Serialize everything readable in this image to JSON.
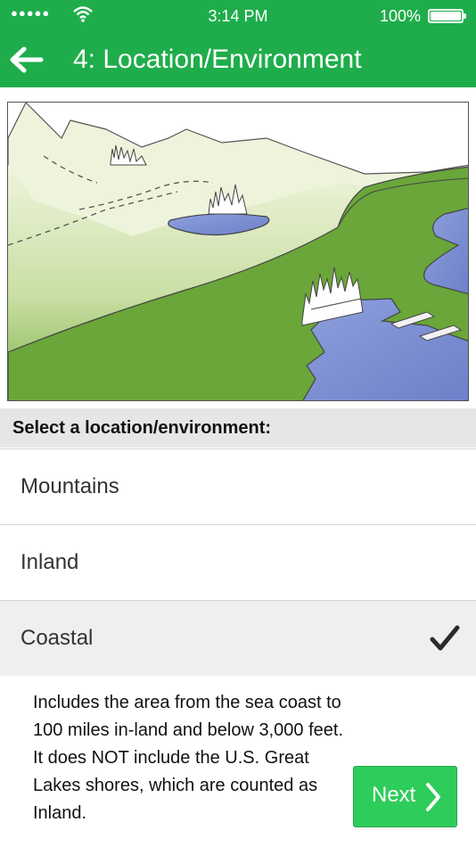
{
  "status_bar": {
    "signal": "●●●●●",
    "time": "3:14 PM",
    "battery": "100%"
  },
  "nav": {
    "title": "4: Location/Environment",
    "back_icon": "back-arrow-icon"
  },
  "section": {
    "header": "Select a location/environment:"
  },
  "options": [
    {
      "label": "Mountains",
      "selected": false
    },
    {
      "label": "Inland",
      "selected": false
    },
    {
      "label": "Coastal",
      "selected": true
    }
  ],
  "description": "Includes the area from the sea coast to 100 miles in-land and below 3,000 feet. It does NOT include the U.S. Great Lakes shores, which are counted as Inland.",
  "next_button": {
    "label": "Next",
    "icon": "chevron-right-icon"
  },
  "colors": {
    "brand_green": "#1fad4b",
    "button_green": "#2ecc5a"
  }
}
